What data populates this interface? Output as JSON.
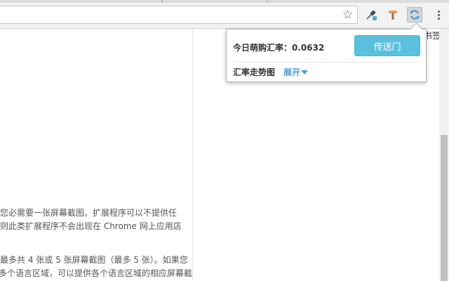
{
  "browser": {
    "bookmark_star_icon": "star-outline-icon",
    "extensions": [
      {
        "name": "color-dropper-extension",
        "icon": "eyedropper-icon"
      },
      {
        "name": "hammer-extension",
        "icon": "hammer-icon"
      },
      {
        "name": "exchange-rate-extension",
        "icon": "refresh-circle-icon",
        "active": true
      }
    ],
    "menu_icon": "vertical-dots-icon",
    "bookmarks_bar_label": "书签"
  },
  "page": {
    "paragraph1": [
      "您必需要一张屏幕截图。扩展程序可以不提供任",
      "则此类扩展程序不会出现在 Chrome 网上应用店"
    ],
    "paragraph2": [
      "最多共 4 张或 5 张屏幕截图（最多 5 张）。如果您",
      "多个语言区域，可以提供各个语言区域的相应屏幕截"
    ]
  },
  "popup": {
    "rate_label": "今日萌购汇率：",
    "rate_value": "0.0632",
    "teleport_button": "传送门",
    "trend_label": "汇率走势图",
    "expand_link": "展开",
    "accent_color": "#5bc0de"
  }
}
